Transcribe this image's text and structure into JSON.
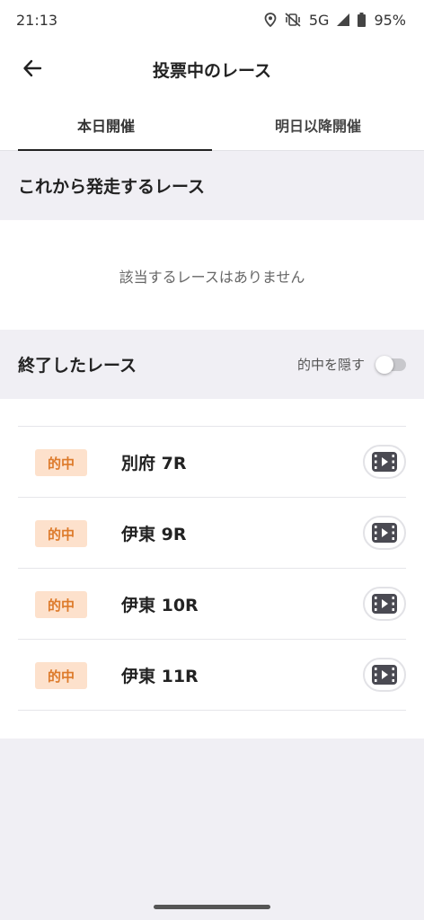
{
  "status_bar": {
    "time": "21:13",
    "network": "5G",
    "battery": "95%",
    "icons": [
      "location-icon",
      "vibrate-off-icon",
      "signal-icon",
      "battery-icon"
    ]
  },
  "app_bar": {
    "back_icon": "arrow-left-icon",
    "title": "投票中のレース"
  },
  "tabs": [
    {
      "label": "本日開催",
      "active": true
    },
    {
      "label": "明日以降開催",
      "active": false
    }
  ],
  "upcoming": {
    "title": "これから発走するレース",
    "empty_message": "該当するレースはありません"
  },
  "finished": {
    "title": "終了したレース",
    "toggle_label": "的中を隠す",
    "toggle_on": false,
    "races": [
      {
        "badge": "的中",
        "name": "別府 7R",
        "icon": "video-icon"
      },
      {
        "badge": "的中",
        "name": "伊東 9R",
        "icon": "video-icon"
      },
      {
        "badge": "的中",
        "name": "伊東 10R",
        "icon": "video-icon"
      },
      {
        "badge": "的中",
        "name": "伊東 11R",
        "icon": "video-icon"
      }
    ]
  },
  "colors": {
    "badge_bg": "#fde1cc",
    "badge_text": "#dd7a2a",
    "page_bg": "#f0eff4"
  }
}
